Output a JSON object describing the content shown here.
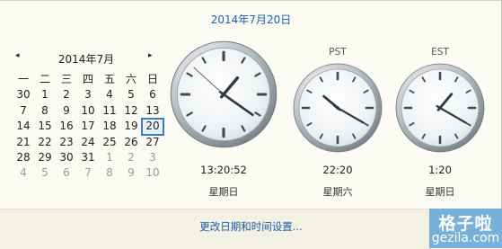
{
  "header": {
    "date_long": "2014年7月20日"
  },
  "calendar": {
    "prev_icon": "◂",
    "next_icon": "▸",
    "month_label": "2014年7月",
    "weekdays": [
      "一",
      "二",
      "三",
      "四",
      "五",
      "六",
      "日"
    ],
    "rows": [
      [
        {
          "d": "30",
          "dim": false
        },
        {
          "d": "1",
          "dim": false
        },
        {
          "d": "2",
          "dim": false
        },
        {
          "d": "3",
          "dim": false
        },
        {
          "d": "4",
          "dim": false
        },
        {
          "d": "5",
          "dim": false
        },
        {
          "d": "6",
          "dim": false
        }
      ],
      [
        {
          "d": "7",
          "dim": false
        },
        {
          "d": "8",
          "dim": false
        },
        {
          "d": "9",
          "dim": false
        },
        {
          "d": "10",
          "dim": false
        },
        {
          "d": "11",
          "dim": false
        },
        {
          "d": "12",
          "dim": false
        },
        {
          "d": "13",
          "dim": false
        }
      ],
      [
        {
          "d": "14",
          "dim": false
        },
        {
          "d": "15",
          "dim": false
        },
        {
          "d": "16",
          "dim": false
        },
        {
          "d": "17",
          "dim": false
        },
        {
          "d": "18",
          "dim": false
        },
        {
          "d": "19",
          "dim": false
        },
        {
          "d": "20",
          "dim": false,
          "today": true
        }
      ],
      [
        {
          "d": "21",
          "dim": false
        },
        {
          "d": "22",
          "dim": false
        },
        {
          "d": "23",
          "dim": false
        },
        {
          "d": "24",
          "dim": false
        },
        {
          "d": "25",
          "dim": false
        },
        {
          "d": "26",
          "dim": false
        },
        {
          "d": "27",
          "dim": false
        }
      ],
      [
        {
          "d": "28",
          "dim": false
        },
        {
          "d": "29",
          "dim": false
        },
        {
          "d": "30",
          "dim": false
        },
        {
          "d": "31",
          "dim": false
        },
        {
          "d": "1",
          "dim": true
        },
        {
          "d": "2",
          "dim": true
        },
        {
          "d": "3",
          "dim": true
        }
      ],
      [
        {
          "d": "4",
          "dim": true
        },
        {
          "d": "5",
          "dim": true
        },
        {
          "d": "6",
          "dim": true
        },
        {
          "d": "7",
          "dim": true
        },
        {
          "d": "8",
          "dim": true
        },
        {
          "d": "9",
          "dim": true
        },
        {
          "d": "10",
          "dim": true
        }
      ]
    ]
  },
  "clocks": {
    "local": {
      "label": "",
      "time": "13:20:52",
      "day": "星期日",
      "hour": 13,
      "minute": 20,
      "second": 52
    },
    "pst": {
      "label": "PST",
      "time": "22:20",
      "day": "星期六",
      "hour": 22,
      "minute": 20
    },
    "est": {
      "label": "EST",
      "time": "1:20",
      "day": "星期日",
      "hour": 1,
      "minute": 20
    }
  },
  "footer": {
    "link": "更改日期和时间设置..."
  },
  "watermark": {
    "line1": "格子啦",
    "line2": "gezila.com"
  },
  "colors": {
    "accent": "#1b5fa8",
    "today_border": "#3c7fc1"
  }
}
